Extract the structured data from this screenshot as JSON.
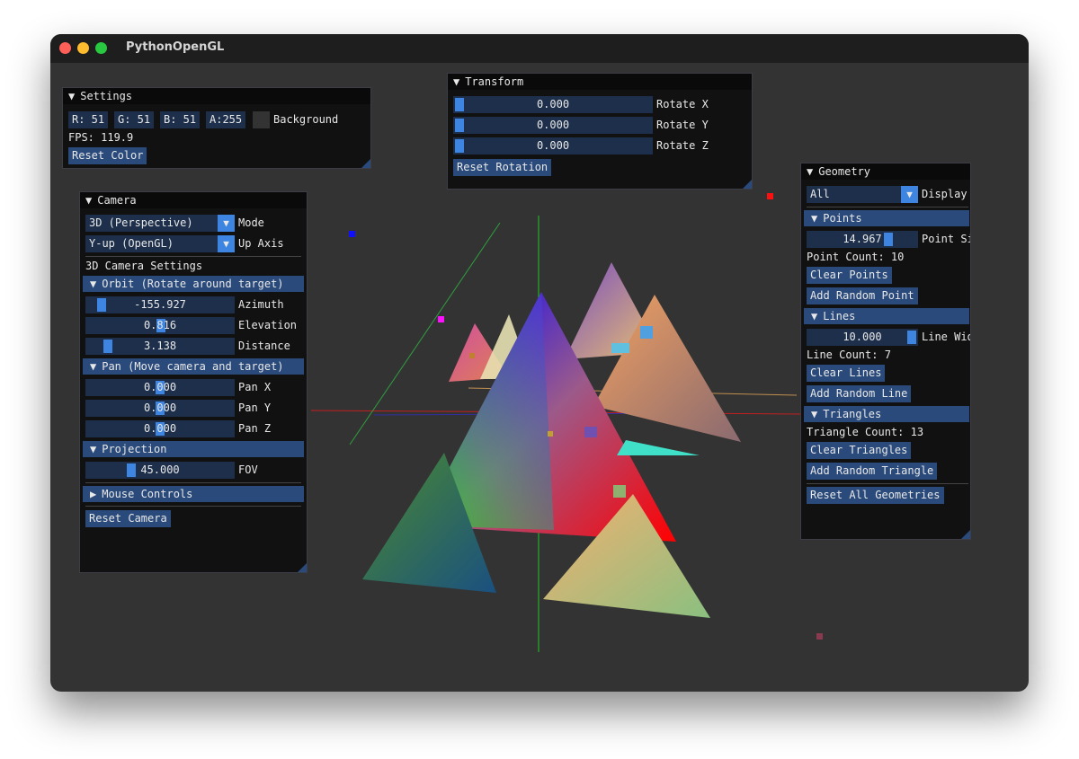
{
  "window": {
    "title": "PythonOpenGL"
  },
  "settings": {
    "title": "Settings",
    "r": "R: 51",
    "g": "G: 51",
    "b": "B: 51",
    "a": "A:255",
    "background_label": "Background",
    "fps": "FPS: 119.9",
    "reset_color": "Reset Color"
  },
  "transform": {
    "title": "Transform",
    "rotate_x": {
      "value": "0.000",
      "label": "Rotate X",
      "fraction": 0.0
    },
    "rotate_y": {
      "value": "0.000",
      "label": "Rotate Y",
      "fraction": 0.0
    },
    "rotate_z": {
      "value": "0.000",
      "label": "Rotate Z",
      "fraction": 0.0
    },
    "reset_rotation": "Reset Rotation"
  },
  "camera": {
    "title": "Camera",
    "mode_value": "3D (Perspective)",
    "mode_label": "Mode",
    "up_value": "Y-up (OpenGL)",
    "up_label": "Up Axis",
    "settings_label": "3D Camera Settings",
    "orbit_header": "Orbit (Rotate around target)",
    "azimuth": {
      "value": "-155.927",
      "label": "Azimuth"
    },
    "elevation": {
      "value": "0.816",
      "label": "Elevation"
    },
    "distance": {
      "value": "3.138",
      "label": "Distance"
    },
    "pan_header": "Pan (Move camera and target)",
    "pan_x": {
      "value": "0.000",
      "label": "Pan X"
    },
    "pan_y": {
      "value": "0.000",
      "label": "Pan Y"
    },
    "pan_z": {
      "value": "0.000",
      "label": "Pan Z"
    },
    "projection_header": "Projection",
    "fov": {
      "value": "45.000",
      "label": "FOV"
    },
    "mouse_header": "Mouse Controls",
    "reset_camera": "Reset Camera"
  },
  "geometry": {
    "title": "Geometry",
    "display_value": "All",
    "display_label": "Display",
    "points_header": "Points",
    "point_size": {
      "value": "14.967",
      "label": "Point Si"
    },
    "point_count": "Point Count: 10",
    "clear_points": "Clear Points",
    "add_point": "Add Random Point",
    "lines_header": "Lines",
    "line_width": {
      "value": "10.000",
      "label": "Line Wid"
    },
    "line_count": "Line Count: 7",
    "clear_lines": "Clear Lines",
    "add_line": "Add Random Line",
    "triangles_header": "Triangles",
    "triangle_count": "Triangle Count: 13",
    "clear_triangles": "Clear Triangles",
    "add_triangle": "Add Random Triangle",
    "reset_all": "Reset All Geometries"
  },
  "icons": {
    "expanded": "▼",
    "collapsed": "▶"
  },
  "colors": {
    "accent": "#3d85e0",
    "header": "#294a7a",
    "frame": "#1d2f4b",
    "background": "#333333"
  }
}
